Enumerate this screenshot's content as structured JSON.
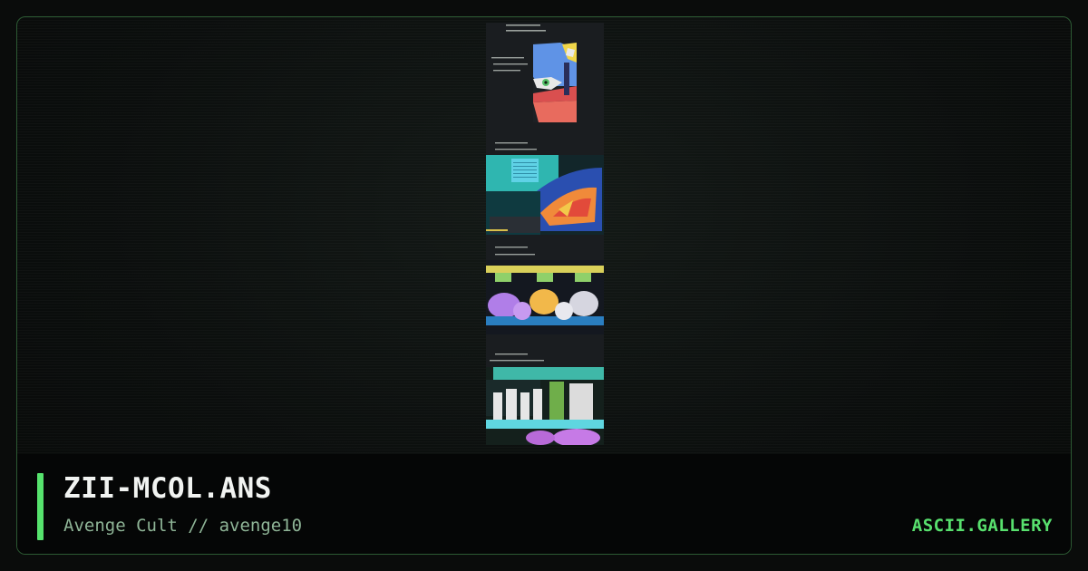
{
  "artwork": {
    "filename": "ZII-MCOL.ANS",
    "credit": "Avenge Cult // avenge10"
  },
  "site": {
    "brand": "ASCII.GALLERY"
  },
  "colors": {
    "accent": "#56e36d",
    "frame_border": "#2c5a33",
    "background": "#0a0c0b",
    "infobar": "#050606"
  }
}
